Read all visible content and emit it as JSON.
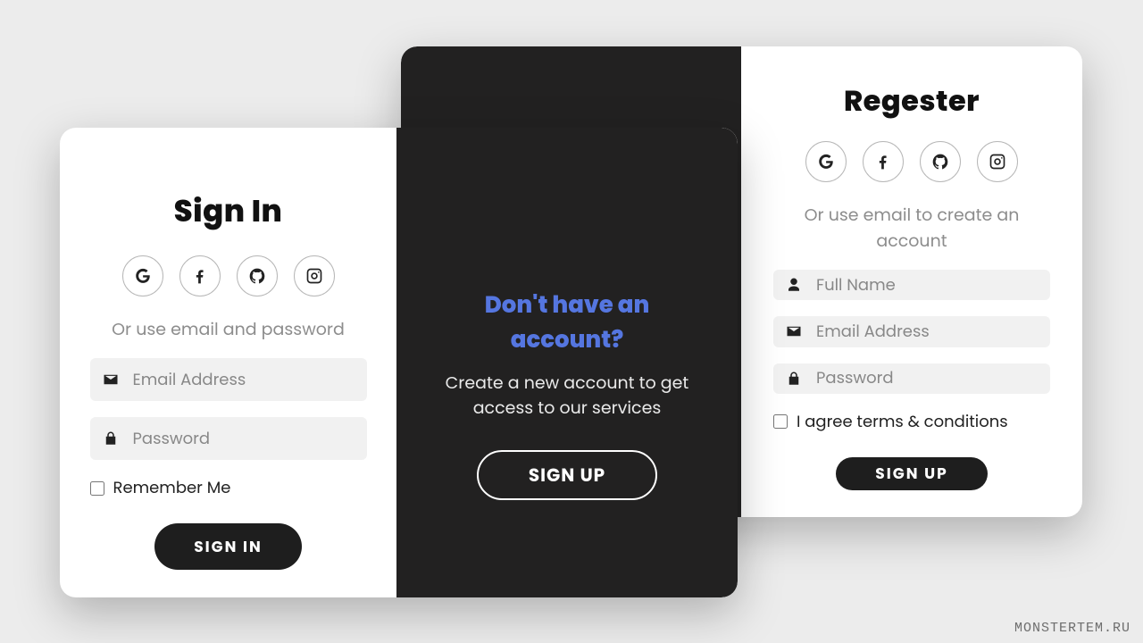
{
  "colors": {
    "dark": "#222121",
    "accent_link": "#5576e0",
    "input_bg": "#f1f1f1",
    "hint": "#8d8d8d"
  },
  "signin": {
    "title": "Sign In",
    "hint": "Or use email and password",
    "email_placeholder": "Email Address",
    "password_placeholder": "Password",
    "remember_label": "Remember Me",
    "submit_label": "SIGN IN",
    "social_icons": [
      "google",
      "facebook",
      "github",
      "instagram"
    ]
  },
  "promo": {
    "title": "Don't have an account?",
    "subtitle": "Create a new account to get access to our services",
    "button_label": "SIGN UP"
  },
  "register": {
    "title": "Regester",
    "hint": "Or use email to create an account",
    "name_placeholder": "Full Name",
    "email_placeholder": "Email Address",
    "password_placeholder": "Password",
    "terms_label": "I agree terms & conditions",
    "submit_label": "SIGN UP",
    "social_icons": [
      "google",
      "facebook",
      "github",
      "instagram"
    ]
  },
  "watermark": "MONSTERTEM.RU"
}
